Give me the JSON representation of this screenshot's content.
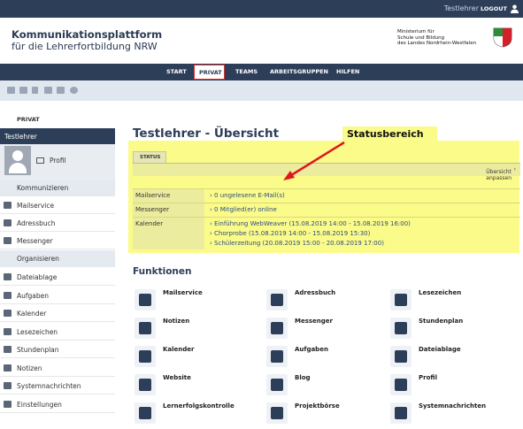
{
  "topbar": {
    "user": "Testlehrer",
    "logout": "LOGOUT"
  },
  "header": {
    "title1": "Kommunikationsplattform",
    "title2": "für die Lehrerfortbildung NRW",
    "ministry": [
      "Ministerium für",
      "Schule und Bildung",
      "des Landes Nordrhein-Westfalen"
    ]
  },
  "nav": [
    "START",
    "PRIVAT",
    "TEAMS",
    "ARBEITSGRUPPEN",
    "HILFEN"
  ],
  "sidebar": {
    "heading": "PRIVAT",
    "user": "Testlehrer",
    "profile": "Profil",
    "sections": [
      "Kommunizieren",
      "Organisieren"
    ],
    "communicate": [
      "Mailservice",
      "Adressbuch",
      "Messenger"
    ],
    "organize": [
      "Dateiablage",
      "Aufgaben",
      "Kalender",
      "Lesezeichen",
      "Stundenplan",
      "Notizen",
      "Systemnachrichten",
      "Einstellungen"
    ]
  },
  "main": {
    "title": "Testlehrer - Übersicht",
    "callout": "Statusbereich",
    "status_tab": "STATUS",
    "adjust": "Übersicht anpassen",
    "rows": [
      {
        "label": "Mailservice",
        "values": [
          "0 ungelesene E-Mail(s)"
        ]
      },
      {
        "label": "Messenger",
        "values": [
          "0 Mitglied(er) online"
        ]
      },
      {
        "label": "Kalender",
        "values": [
          "Einführung WebWeaver (15.08.2019 14:00 - 15.08.2019 16:00)",
          "Chorprobe (15.08.2019 14:00 - 15.08.2019 15:30)",
          "Schülerzeitung (20.08.2019 15:00 - 20.08.2019 17:00)"
        ]
      }
    ],
    "functions_title": "Funktionen",
    "functions": [
      [
        "Mailservice",
        "Adressbuch",
        "Lesezeichen"
      ],
      [
        "Notizen",
        "Messenger",
        "Stundenplan"
      ],
      [
        "Kalender",
        "Aufgaben",
        "Dateiablage"
      ],
      [
        "Website",
        "Blog",
        "Profil"
      ],
      [
        "Lernerfolgskontrolle",
        "Projektbörse",
        "Systemnachrichten"
      ]
    ]
  },
  "colors": {
    "dark": "#2d3e59",
    "highlight": "#fbfb8a",
    "arrow": "#e0161b"
  }
}
